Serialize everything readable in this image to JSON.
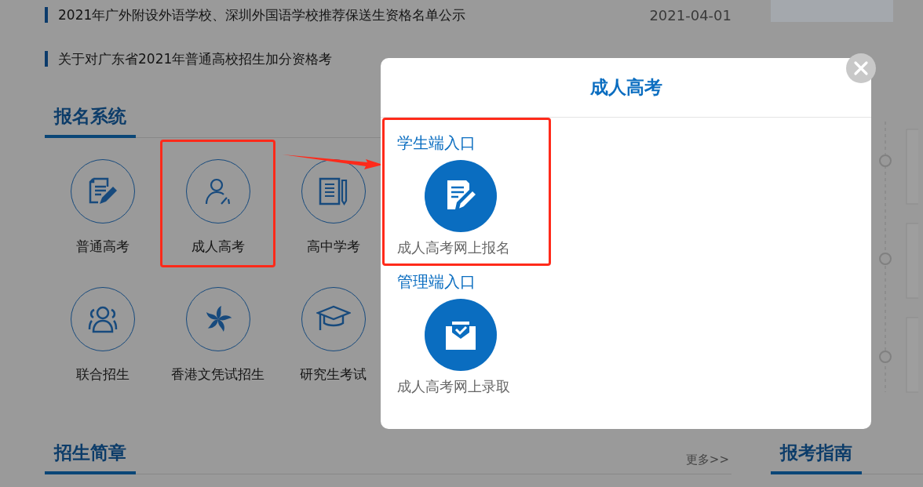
{
  "news": [
    {
      "title": "2021年广外附设外语学校、深圳外国语学校推荐保送生资格名单公示",
      "date": "2021-04-01"
    },
    {
      "title": "关于对广东省2021年普通高校招生加分资格考"
    }
  ],
  "registration": {
    "heading": "报名系统",
    "items": [
      {
        "label": "普通高考",
        "highlighted": false
      },
      {
        "label": "成人高考",
        "highlighted": true
      },
      {
        "label": "高中学考",
        "highlighted": false
      },
      {
        "label": "联合招生",
        "highlighted": false
      },
      {
        "label": "香港文凭试招生",
        "highlighted": false
      },
      {
        "label": "研究生考试",
        "highlighted": false
      }
    ]
  },
  "brochure": {
    "heading": "招生简章",
    "more": "更多>>"
  },
  "guide": {
    "heading": "报考指南"
  },
  "modal": {
    "title": "成人高考",
    "sections": [
      {
        "heading": "学生端入口",
        "entry": "成人高考网上报名",
        "highlighted": true
      },
      {
        "heading": "管理端入口",
        "entry": "成人高考网上录取",
        "highlighted": false
      }
    ]
  }
}
